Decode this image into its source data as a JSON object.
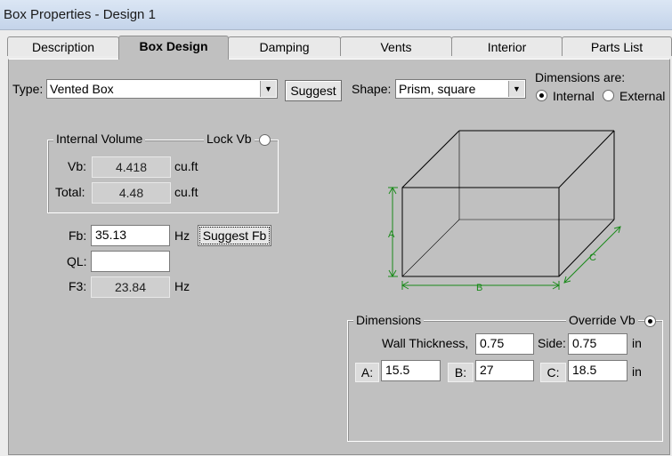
{
  "window": {
    "title": "Box Properties - Design 1"
  },
  "tabs": [
    {
      "label": "Description"
    },
    {
      "label": "Box Design"
    },
    {
      "label": "Damping"
    },
    {
      "label": "Vents"
    },
    {
      "label": "Interior"
    },
    {
      "label": "Parts List"
    }
  ],
  "active_tab": "Box Design",
  "type": {
    "label": "Type:",
    "value": "Vented Box",
    "suggest_button": "Suggest"
  },
  "shape": {
    "label": "Shape:",
    "value": "Prism, square"
  },
  "dimensions_are": {
    "label": "Dimensions are:",
    "internal": "Internal",
    "external": "External",
    "selected": "Internal"
  },
  "internal_volume": {
    "title": "Internal Volume",
    "lock_label": "Lock Vb",
    "vb_label": "Vb:",
    "vb_value": "4.418",
    "vb_unit": "cu.ft",
    "total_label": "Total:",
    "total_value": "4.48",
    "total_unit": "cu.ft"
  },
  "tuning": {
    "fb_label": "Fb:",
    "fb_value": "35.13",
    "fb_unit": "Hz",
    "suggest_fb_button": "Suggest Fb",
    "ql_label": "QL:",
    "ql_value": "",
    "f3_label": "F3:",
    "f3_value": "23.84",
    "f3_unit": "Hz"
  },
  "diagram": {
    "label_a": "A",
    "label_b": "B",
    "label_c": "C"
  },
  "dimensions": {
    "title": "Dimensions",
    "override_label": "Override Vb",
    "wall_label": "Wall Thickness,",
    "wall_value": "0.75",
    "side_label": "Side:",
    "side_value": "0.75",
    "unit": "in",
    "a_label": "A:",
    "a_value": "15.5",
    "b_label": "B:",
    "b_value": "27",
    "c_label": "C:",
    "c_value": "18.5",
    "c_unit": "in"
  },
  "colors": {
    "dimension_line": "#1a8a1a",
    "panel_bg": "#c0c0c0"
  }
}
